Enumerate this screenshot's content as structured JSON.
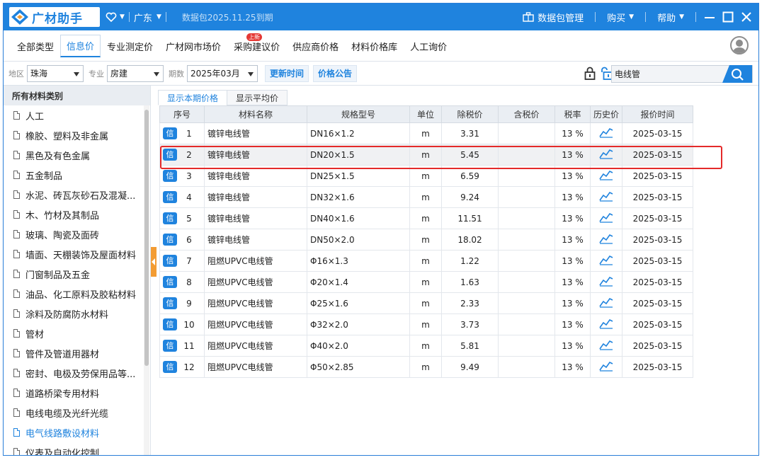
{
  "app": {
    "title": "广材助手",
    "region": "广东",
    "pack_expire": "数据包2025.11.25到期",
    "colors": {
      "brand": "#1f83de",
      "highlight": "#e42a2a",
      "handle": "#f39c33"
    }
  },
  "titlebar": {
    "data_pack_label": "数据包管理",
    "buy_label": "购买",
    "help_label": "帮助"
  },
  "tabs": [
    {
      "label": "全部类型",
      "active": false
    },
    {
      "label": "信息价",
      "active": true
    },
    {
      "label": "专业测定价",
      "active": false
    },
    {
      "label": "广材网市场价",
      "active": false
    },
    {
      "label": "采购建议价",
      "active": false,
      "badge": "上新"
    },
    {
      "label": "供应商价格",
      "active": false
    },
    {
      "label": "材料价格库",
      "active": false
    },
    {
      "label": "人工询价",
      "active": false
    }
  ],
  "filters": {
    "region_label": "地区",
    "region_value": "珠海",
    "major_label": "专业",
    "major_value": "房建",
    "period_label": "期数",
    "period_value": "2025年03月",
    "refresh_label": "更新时间",
    "notice_label": "价格公告",
    "search_value": "电线管"
  },
  "sidebar": {
    "header": "所有材料类别",
    "items": [
      "人工",
      "橡胶、塑料及非金属",
      "黑色及有色金属",
      "五金制品",
      "水泥、砖瓦灰砂石及混凝...",
      "木、竹材及其制品",
      "玻璃、陶瓷及面砖",
      "墙面、天棚装饰及屋面材料",
      "门窗制品及五金",
      "油品、化工原料及胶粘材料",
      "涂料及防腐防水材料",
      "管材",
      "管件及管道用器材",
      "密封、电极及劳保用品等...",
      "道路桥梁专用材料",
      "电线电缆及光纤光缆",
      "电气线路敷设材料",
      "仪表及自动化控制"
    ],
    "active_index": 16
  },
  "subtabs": [
    "显示本期价格",
    "显示平均价"
  ],
  "table": {
    "tag_label": "信",
    "columns": [
      "序号",
      "材料名称",
      "规格型号",
      "单位",
      "除税价",
      "含税价",
      "税率",
      "历史价",
      "报价时间"
    ],
    "rows": [
      [
        "1",
        "镀锌电线管",
        "DN16×1.2",
        "m",
        "3.31",
        "",
        "13 %",
        "2025-03-15"
      ],
      [
        "2",
        "镀锌电线管",
        "DN20×1.5",
        "m",
        "5.45",
        "",
        "13 %",
        "2025-03-15"
      ],
      [
        "3",
        "镀锌电线管",
        "DN25×1.5",
        "m",
        "6.59",
        "",
        "13 %",
        "2025-03-15"
      ],
      [
        "4",
        "镀锌电线管",
        "DN32×1.6",
        "m",
        "9.24",
        "",
        "13 %",
        "2025-03-15"
      ],
      [
        "5",
        "镀锌电线管",
        "DN40×1.6",
        "m",
        "11.51",
        "",
        "13 %",
        "2025-03-15"
      ],
      [
        "6",
        "镀锌电线管",
        "DN50×2.0",
        "m",
        "18.02",
        "",
        "13 %",
        "2025-03-15"
      ],
      [
        "7",
        "阻燃UPVC电线管",
        "Φ16×1.3",
        "m",
        "1.22",
        "",
        "13 %",
        "2025-03-15"
      ],
      [
        "8",
        "阻燃UPVC电线管",
        "Φ20×1.4",
        "m",
        "1.63",
        "",
        "13 %",
        "2025-03-15"
      ],
      [
        "9",
        "阻燃UPVC电线管",
        "Φ25×1.6",
        "m",
        "2.33",
        "",
        "13 %",
        "2025-03-15"
      ],
      [
        "10",
        "阻燃UPVC电线管",
        "Φ32×2.0",
        "m",
        "3.73",
        "",
        "13 %",
        "2025-03-15"
      ],
      [
        "11",
        "阻燃UPVC电线管",
        "Φ40×2.0",
        "m",
        "5.81",
        "",
        "13 %",
        "2025-03-15"
      ],
      [
        "12",
        "阻燃UPVC电线管",
        "Φ50×2.85",
        "m",
        "9.49",
        "",
        "13 %",
        "2025-03-15"
      ]
    ],
    "selected_index": 1
  }
}
